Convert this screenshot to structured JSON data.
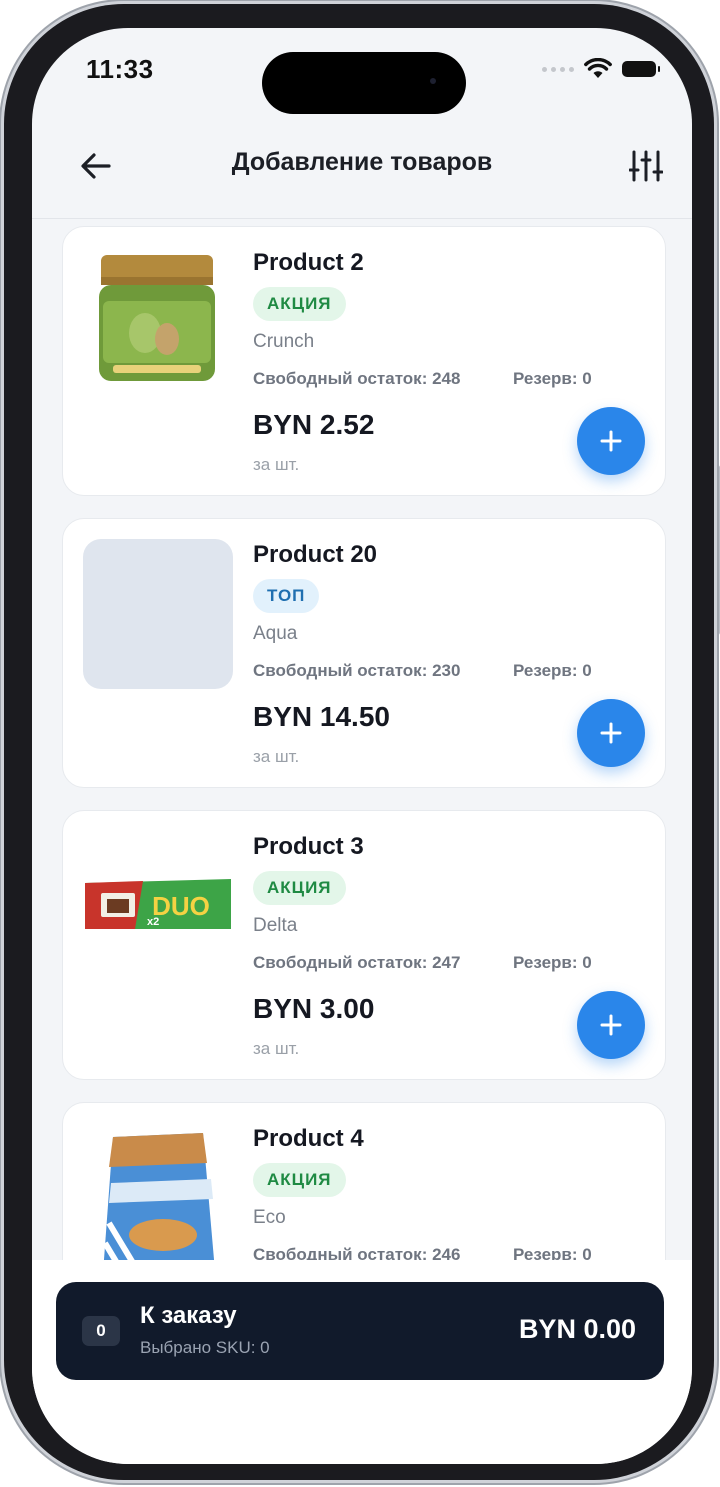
{
  "status_bar": {
    "time": "11:33"
  },
  "header": {
    "title": "Добавление товаров"
  },
  "products": [
    {
      "name": "Product 2",
      "badge": "АКЦИЯ",
      "brand": "Crunch",
      "stock": "Свободный остаток: 248",
      "reserve": "Резерв: 0",
      "price": "BYN 2.52",
      "unit": "за шт.",
      "image": "jar-image"
    },
    {
      "name": "Product 20",
      "badge": "ТОП",
      "brand": "Aqua",
      "stock": "Свободный остаток: 230",
      "reserve": "Резерв: 0",
      "price": "BYN 14.50",
      "unit": "за шт.",
      "image": "placeholder"
    },
    {
      "name": "Product 3",
      "badge": "АКЦИЯ",
      "brand": "Delta",
      "stock": "Свободный остаток: 247",
      "reserve": "Резерв: 0",
      "price": "BYN 3.00",
      "unit": "за шт.",
      "image": "bar-image",
      "image_text": "DUO",
      "image_text2": "x2"
    },
    {
      "name": "Product 4",
      "badge": "АКЦИЯ",
      "brand": "Eco",
      "stock": "Свободный остаток: 246",
      "reserve": "Резерв: 0",
      "image": "bag-image"
    }
  ],
  "order_bar": {
    "count": "0",
    "title": "К заказу",
    "subtitle": "Выбрано SKU: 0",
    "total": "BYN 0.00"
  },
  "colors": {
    "accent": "#2a86ea",
    "dark": "#111a2b",
    "promo_badge": "#1f8a43",
    "top_badge": "#1f6fb0"
  }
}
